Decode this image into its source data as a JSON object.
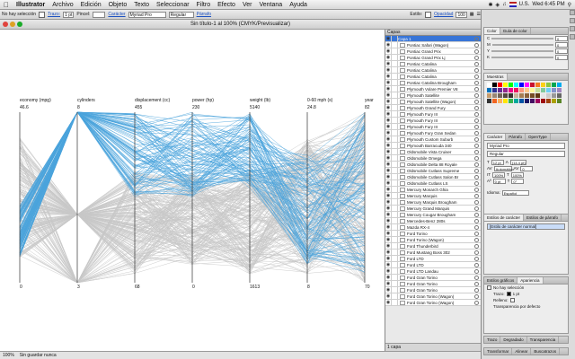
{
  "menubar": {
    "apple": "",
    "app": "Illustrator",
    "items": [
      "Archivo",
      "Edición",
      "Objeto",
      "Texto",
      "Seleccionar",
      "Filtro",
      "Efecto",
      "Ver",
      "Ventana",
      "Ayuda"
    ],
    "status": {
      "locale": "U.S.",
      "clock": "Wed 6:45 PM"
    }
  },
  "control_bar": {
    "selection": "No hay selección",
    "stroke_label": "Trazo:",
    "stroke_value": "1 pt",
    "brush_label": "Pincel:",
    "character_label": "Carácter",
    "font": "Myriad Pro",
    "style": "Regular",
    "paragraph_label": "Párrafo",
    "size": "12 pt",
    "style_label": "Estilo:",
    "opacity_label": "Opacidad",
    "opacity_value": "100"
  },
  "document": {
    "title": "Sin título-1 al 100% (CMYK/Previsualizar)"
  },
  "status_bar": {
    "zoom": "100%",
    "info": "Sin guardar nunca"
  },
  "chart_data": {
    "type": "parallel-coordinates",
    "axes": [
      {
        "label": "economy (mpg)",
        "max": "46.6",
        "min": "0"
      },
      {
        "label": "cylinders",
        "max": "8",
        "min": "3"
      },
      {
        "label": "displacement (cc)",
        "max": "455",
        "min": "68"
      },
      {
        "label": "power (hp)",
        "max": "230",
        "min": "0"
      },
      {
        "label": "weight (lb)",
        "max": "5140",
        "min": "1613"
      },
      {
        "label": "0-60 mph (s)",
        "max": "24.8",
        "min": "8"
      },
      {
        "label": "year",
        "max": "82",
        "min": "70"
      }
    ],
    "colors": {
      "highlight": "#4aa3dc",
      "context": "#c8c8c8"
    }
  },
  "layers_panel": {
    "tab": "Capas",
    "top_layer": "Capa 1",
    "items": [
      "Pontiac Safari (Wagon)",
      "Pontiac Grand Prix",
      "Pontiac Grand Prix Lj",
      "Pontiac Catalina",
      "Pontiac Catalina",
      "Pontiac Catalina",
      "Pontiac Catalina Brougham",
      "Plymouth Volare Premier V8",
      "Plymouth Satellite",
      "Plymouth Satellite (Wagon)",
      "Plymouth Grand Fury",
      "Plymouth Fury III",
      "Plymouth Fury III",
      "Plymouth Fury III",
      "Plymouth Fury Gran Sedan",
      "Plymouth Custom Suburb",
      "Plymouth Barracuda 340",
      "Oldsmobile Vista Cruiser",
      "Oldsmobile Omega",
      "Oldsmobile Delta 88 Royale",
      "Oldsmobile Cutlass Supreme",
      "Oldsmobile Cutlass Salon Br",
      "Oldsmobile Cutlass LS",
      "Mercury Monarch Ghia",
      "Mercury Marquis",
      "Mercury Marquis Brougham",
      "Mercury Grand Marquis",
      "Mercury Cougar Brougham",
      "Mercedes-Benz 280s",
      "Mazda RX-4",
      "Ford Torino",
      "Ford Torino (Wagon)",
      "Ford Thunderbird",
      "Ford Mustang Boss 302",
      "Ford LTD",
      "Ford LTD",
      "Ford LTD Landau",
      "Ford Gran Torino",
      "Ford Gran Torino",
      "Ford Gran Torino",
      "Ford Gran Torino (Wagon)",
      "Ford Gran Torino (Wagon)"
    ],
    "footer": "1 capa"
  },
  "color_panel": {
    "tabs": [
      "Color",
      "Guía de color"
    ],
    "channels": [
      {
        "label": "C",
        "value": "0"
      },
      {
        "label": "M",
        "value": "0"
      },
      {
        "label": "Y",
        "value": "0"
      },
      {
        "label": "K",
        "value": "0"
      }
    ]
  },
  "swatches_panel": {
    "tab": "Muestras",
    "colors": [
      "#ffffff",
      "#000000",
      "#ff0000",
      "#ffff00",
      "#00ff00",
      "#00ffff",
      "#0000ff",
      "#ff00ff",
      "#c8102e",
      "#f47920",
      "#fcd116",
      "#8dc63f",
      "#00a651",
      "#00aeef",
      "#0072bc",
      "#2e3192",
      "#662d91",
      "#92278f",
      "#ec008c",
      "#ed145b",
      "#f7977a",
      "#fdc689",
      "#fff799",
      "#c4df9b",
      "#82ca9c",
      "#6dcff6",
      "#8393ca",
      "#a186be",
      "#c69c6d",
      "#998675",
      "#736357",
      "#534741",
      "#362f2d",
      "#c7b299",
      "#a67c52",
      "#8c6239",
      "#754c24",
      "#603913",
      "#e6e6e6",
      "#cccccc",
      "#999999",
      "#666666",
      "#333333",
      "#f26522",
      "#fbaf5d",
      "#ffe600",
      "#39b54a",
      "#00a99d",
      "#0054a6",
      "#1b1464",
      "#440e62",
      "#9e005d",
      "#9e0b0f",
      "#a0410d",
      "#aba000",
      "#598527"
    ]
  },
  "character_panel": {
    "tabs": [
      "Carácter",
      "Párrafo",
      "OpenType"
    ],
    "font": "Myriad Pro",
    "style": "Regular",
    "size": "12 pt",
    "leading": "(14.4 pt)",
    "tracking": "0",
    "kerning": "Automático",
    "scale_v": "100%",
    "scale_h": "100%",
    "baseline": "0 pt",
    "rotation": "0°",
    "language_label": "Idioma:",
    "language": "Español"
  },
  "char_styles_panel": {
    "tabs": [
      "Estilos de carácter",
      "Estilos de párrafo"
    ],
    "item": "[Estilo de carácter normal]"
  },
  "appearance_panel": {
    "tabs": [
      "Estilos gráficos",
      "Apariencia"
    ],
    "title": "No hay selección",
    "rows": [
      {
        "label": "Trazo:",
        "value": "1 pt"
      },
      {
        "label": "Relleno:",
        "value": ""
      },
      {
        "label": "Transparencia por defecto",
        "value": ""
      }
    ]
  },
  "bottom_tabs": {
    "row1": [
      "Trazo",
      "Degradado",
      "Transparencia"
    ],
    "row2": [
      "Transformar",
      "Alinear",
      "Buscatrazos"
    ]
  }
}
